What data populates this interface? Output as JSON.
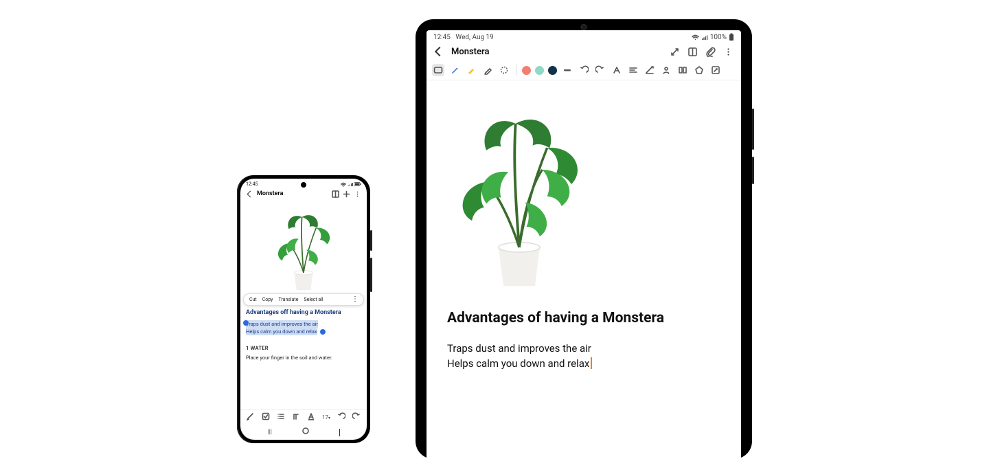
{
  "phone": {
    "status": {
      "time": "12:45"
    },
    "header": {
      "title": "Monstera"
    },
    "context_menu": {
      "cut": "Cut",
      "copy": "Copy",
      "translate": "Translate",
      "select_all": "Select all"
    },
    "note": {
      "title": "Advantages off having a Monstera",
      "line1": "Traps dust and improves the air",
      "line2": "Helps calm you down and relax",
      "section": "1 WATER",
      "body1": "Place your finger in the soil and water."
    },
    "bottom_toolbar": {
      "font_size": "17"
    }
  },
  "tablet": {
    "status": {
      "time": "12:45",
      "date": "Wed, Aug 19",
      "battery": "100%"
    },
    "header": {
      "title": "Monstera"
    },
    "tool_colors": {
      "c1": "#f08070",
      "c2": "#8fd9c8",
      "c3": "#13324a"
    },
    "note": {
      "title": "Advantages of having a Monstera",
      "line1": "Traps dust and improves the air",
      "line2": "Helps calm you down and relax"
    }
  }
}
